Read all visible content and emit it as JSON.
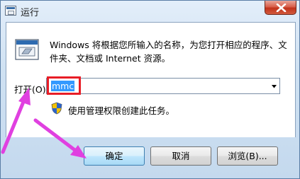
{
  "window": {
    "title": "运行",
    "close_icon": "close-x-icon"
  },
  "content": {
    "run_icon": "run-program-icon",
    "description": "Windows 将根据您所输入的名称，为您打开相应的程序、文件夹、文档或 Internet 资源。",
    "open_label": "打开(O):",
    "input_value": "mmc",
    "admin_notice": "使用管理权限创建此任务。",
    "shield_icon": "uac-shield-icon"
  },
  "buttons": {
    "ok": "确定",
    "cancel": "取消",
    "browse": "浏览(B)..."
  },
  "annotations": {
    "highlight_color": "#e81d26",
    "arrow_color": "#e040e0"
  }
}
